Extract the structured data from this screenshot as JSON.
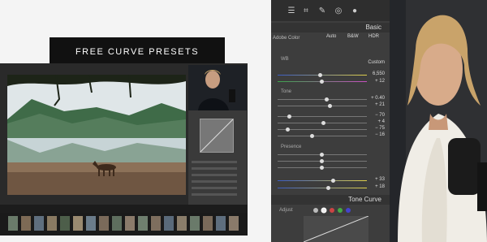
{
  "banner": {
    "title": "FREE CURVE PRESETS"
  },
  "panel": {
    "basic_header": "Basic",
    "treatment": "Adobe Color",
    "modes": [
      "Auto",
      "B&W",
      "HDR"
    ],
    "wb_label": "WB",
    "wb_value": "Custom",
    "temp_value": "6,550",
    "tint_value": "+ 12",
    "tone_label": "Tone",
    "exposure_value": "+ 0.40",
    "contrast_value": "+ 21",
    "highlights_value": "− 70",
    "shadows_value": "+ 4",
    "whites_value": "− 75",
    "blacks_value": "− 16",
    "presence_label": "Presence",
    "vibrance_value": "+ 33",
    "saturation_value": "+ 18",
    "tone_curve_header": "Tone Curve",
    "adjust_label": "Adjust"
  },
  "colors": {
    "panel_bg": "#3d3d3d",
    "banner_bg": "#111111"
  }
}
